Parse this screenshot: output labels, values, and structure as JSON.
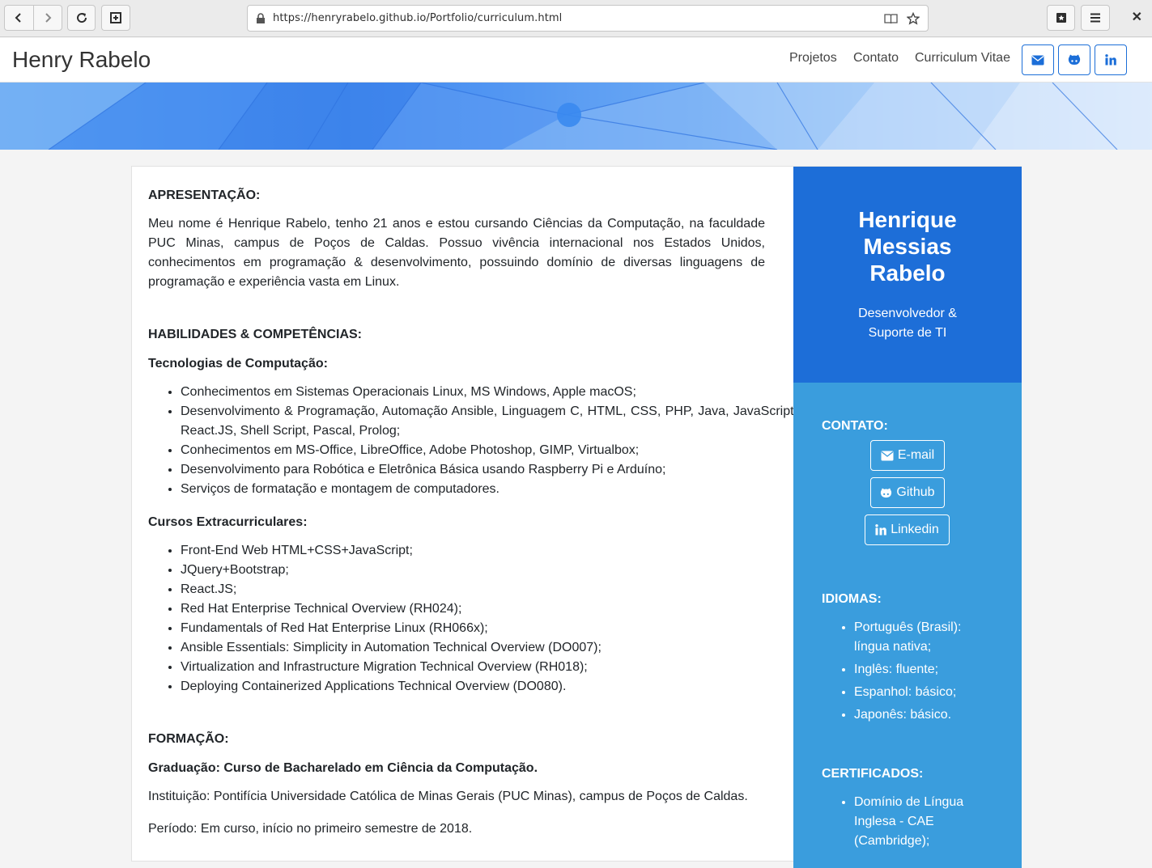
{
  "browser": {
    "url": "https://henryrabelo.github.io/Portfolio/curriculum.html"
  },
  "navbar": {
    "brand": "Henry Rabelo",
    "links": [
      "Projetos",
      "Contato",
      "Curriculum Vitae"
    ],
    "icon_buttons": [
      "envelope-icon",
      "github-icon",
      "linkedin-icon"
    ],
    "accent_color": "#1b6ed8"
  },
  "main": {
    "apresentacao": {
      "heading": "APRESENTAÇÃO:",
      "text": "Meu nome é Henrique Rabelo, tenho 21 anos e estou cursando Ciências da Computação, na faculdade PUC Minas, campus de Poços de Caldas. Possuo vivência internacional nos Estados Unidos, conhecimentos em programação & desenvolvimento, possuindo domínio de diversas linguagens de programação e experiência vasta em Linux."
    },
    "habilidades": {
      "heading": "HABILIDADES & COMPETÊNCIAS:",
      "tech_heading": "Tecnologias de Computação:",
      "tech_items": [
        "Conhecimentos em Sistemas Operacionais Linux, MS Windows, Apple macOS;",
        "Desenvolvimento & Programação, Automação Ansible, Linguagem C, HTML, CSS, PHP, Java, JavaScript, React.JS, Shell Script, Pascal, Prolog;",
        "Conhecimentos em MS-Office, LibreOffice, Adobe Photoshop, GIMP, Virtualbox;",
        "Desenvolvimento para Robótica e Eletrônica Básica usando Raspberry Pi e Arduíno;",
        "Serviços de formatação e montagem de computadores."
      ],
      "courses_heading": "Cursos Extracurriculares:",
      "courses_items": [
        "Front-End Web HTML+CSS+JavaScript;",
        "JQuery+Bootstrap;",
        "React.JS;",
        "Red Hat Enterprise Technical Overview (RH024);",
        "Fundamentals of Red Hat Enterprise Linux (RH066x);",
        "Ansible Essentials: Simplicity in Automation Technical Overview (DO007);",
        "Virtualization and Infrastructure Migration Technical Overview (RH018);",
        "Deploying Containerized Applications Technical Overview (DO080)."
      ]
    },
    "formacao": {
      "heading": "FORMAÇÃO:",
      "degree": "Graduação: Curso de Bacharelado em Ciência da Computação.",
      "institution": "Instituição: Pontifícia Universidade Católica de Minas Gerais (PUC Minas), campus de Poços de Caldas.",
      "period": "Período: Em curso, início no primeiro semestre de 2018."
    }
  },
  "sidebar": {
    "name": "Henrique Messias Rabelo",
    "name_lines": [
      "Henrique",
      "Messias",
      "Rabelo"
    ],
    "role_lines": [
      "Desenvolvedor &",
      "Suporte de TI"
    ],
    "contato_heading": "CONTATO:",
    "contact_buttons": [
      "E-mail",
      "Github",
      "Linkedin"
    ],
    "idiomas_heading": "IDIOMAS:",
    "idiomas": [
      [
        "Português (Brasil):",
        "língua nativa;"
      ],
      [
        "Inglês: fluente;"
      ],
      [
        "Espanhol: básico;"
      ],
      [
        "Japonês: básico."
      ]
    ],
    "certificados_heading": "CERTIFICADOS:",
    "certificados": [
      [
        "Domínio de Língua",
        "Inglesa - CAE",
        "(Cambridge);"
      ]
    ],
    "colors": {
      "top": "#1d6ed8",
      "bottom": "#3a9ddd"
    }
  }
}
